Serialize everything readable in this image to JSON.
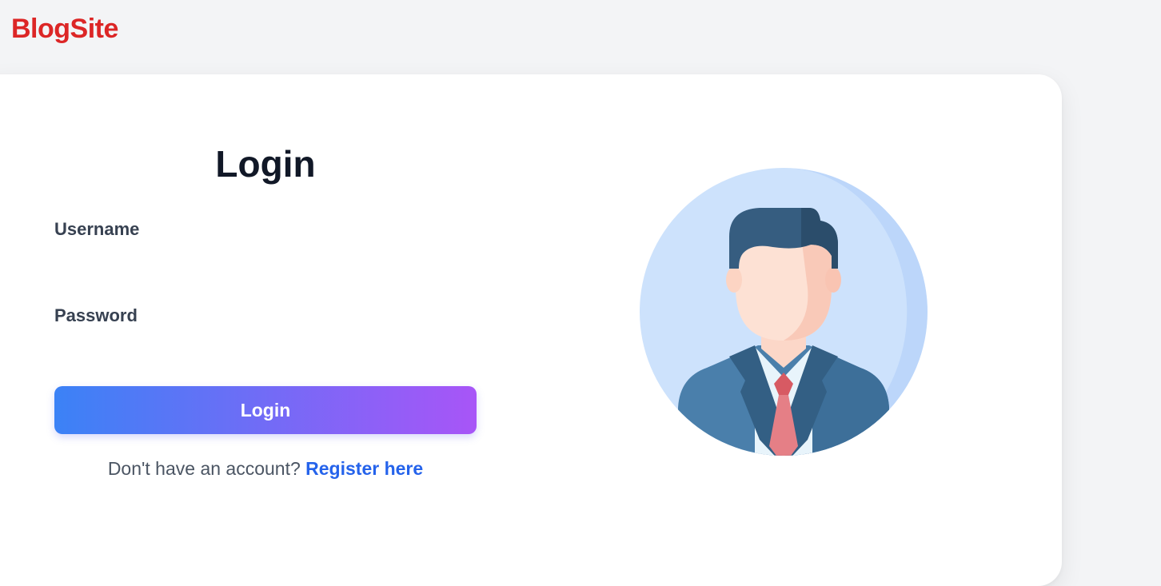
{
  "brand": {
    "name": "BlogSite"
  },
  "login_form": {
    "title": "Login",
    "username_label": "Username",
    "username_value": "",
    "password_label": "Password",
    "password_value": "",
    "submit_label": "Login",
    "register_prompt": "Don't have an account?",
    "register_link": "Register here"
  },
  "illustration": {
    "icon": "user-avatar-icon"
  },
  "colors": {
    "brand": "#dc2626",
    "button_gradient_start": "#3b82f6",
    "button_gradient_end": "#a855f7",
    "link": "#2563eb",
    "page_background": "#f3f4f6",
    "card_background": "#ffffff"
  }
}
